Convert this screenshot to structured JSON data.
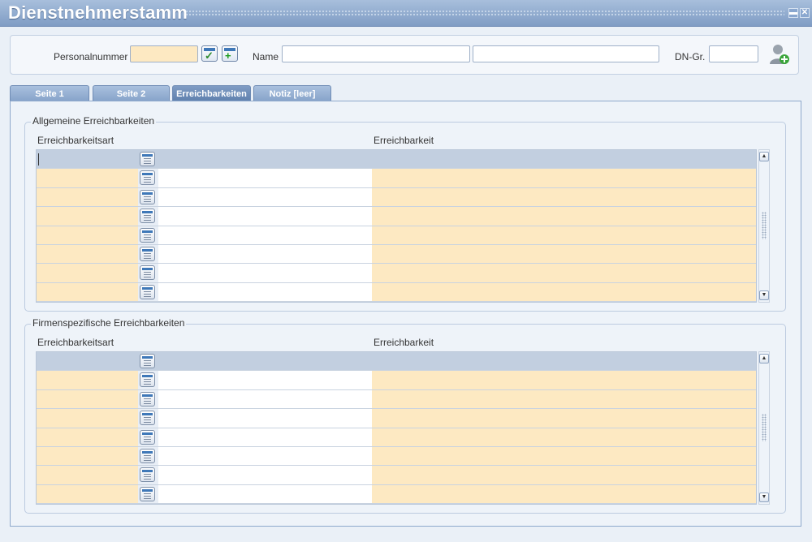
{
  "window": {
    "title": "Dienstnehmerstamm",
    "minimize_symbol": "▬",
    "close_symbol": "✕"
  },
  "header": {
    "personalnummer_label": "Personalnummer",
    "personalnummer_value": "",
    "name_label": "Name",
    "name_first_value": "",
    "name_second_value": "",
    "dngr_label": "DN-Gr.",
    "dngr_value": "",
    "icons": [
      "confirm-check-icon",
      "add-new-icon",
      "add-person-icon"
    ]
  },
  "tabs": [
    {
      "label": "Seite 1",
      "active": false
    },
    {
      "label": "Seite 2",
      "active": false
    },
    {
      "label": "Erreichbarkeiten",
      "active": true
    },
    {
      "label": "Notiz [leer]",
      "active": false
    }
  ],
  "groups": [
    {
      "title": "Allgemeine Erreichbarkeiten",
      "col_art": "Erreichbarkeitsart",
      "col_value": "Erreichbarkeit",
      "rows": 8
    },
    {
      "title": "Firmenspezifische Erreichbarkeiten",
      "col_art": "Erreichbarkeitsart",
      "col_value": "Erreichbarkeit",
      "rows": 8
    }
  ],
  "colors": {
    "titlebar": "#7f9cc4",
    "input_yellow": "#fde9c2",
    "selected_row": "#c2cfe0"
  }
}
